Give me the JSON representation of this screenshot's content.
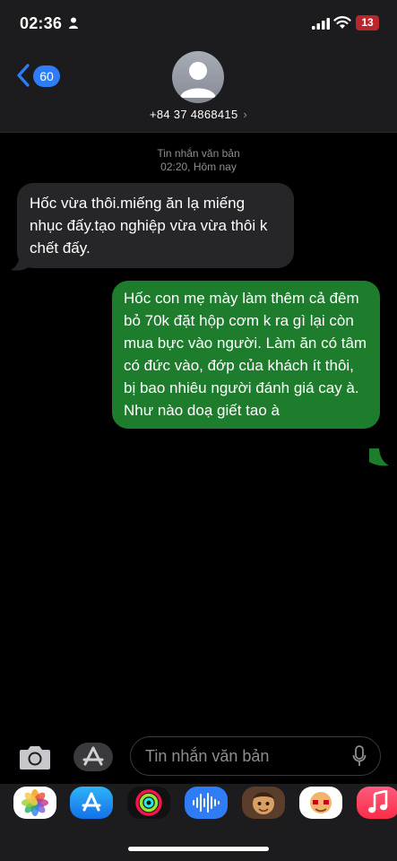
{
  "status": {
    "time": "02:36",
    "battery": "13"
  },
  "header": {
    "back_count": "60",
    "contact": "+84 37 4868415",
    "chevron": "›"
  },
  "thread": {
    "meta_type": "Tin nhắn văn bản",
    "meta_time": "02:20, Hôm nay",
    "messages": [
      {
        "direction": "incoming",
        "text": "Hốc vừa thôi.miếng ăn lạ miếng nhục đấy.tạo nghiệp vừa vừa thôi k chết đấy."
      },
      {
        "direction": "outgoing",
        "text": "Hốc con mẹ mày làm thêm cả đêm bỏ 70k đặt hộp cơm k ra gì lại còn mua bực vào người. Làm ăn có tâm có đức vào, đớp của khách ít thôi, bị bao nhiêu người đánh giá cay à. Như nào doạ giết tao à"
      }
    ]
  },
  "composer": {
    "placeholder": "Tin nhắn văn bản"
  },
  "app_drawer": [
    "photos-icon",
    "app-store-icon",
    "fitness-icon",
    "audio-message-icon",
    "memoji-icon",
    "animoji-icon",
    "music-icon"
  ],
  "colors": {
    "incoming_bubble": "#262628",
    "outgoing_bubble": "#1e7d2d",
    "accent": "#2f7df6"
  }
}
